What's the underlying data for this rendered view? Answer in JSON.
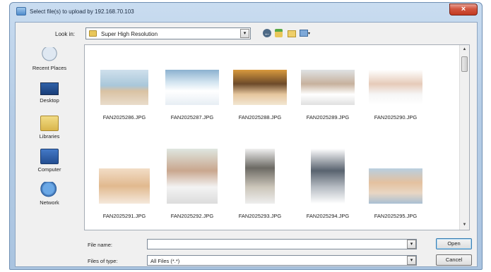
{
  "window": {
    "title": "Select file(s) to upload by 192.168.70.103",
    "close_glyph": "×"
  },
  "toolbar": {
    "look_in_label": "Look in:",
    "look_in_value": "Super High Resolution",
    "dropdown_glyph": "▾",
    "back_glyph": "←"
  },
  "places": [
    {
      "label": "Recent Places",
      "icon": "recent-places-icon"
    },
    {
      "label": "Desktop",
      "icon": "desktop-icon"
    },
    {
      "label": "Libraries",
      "icon": "libraries-icon"
    },
    {
      "label": "Computer",
      "icon": "computer-icon"
    },
    {
      "label": "Network",
      "icon": "network-icon"
    }
  ],
  "files": [
    {
      "name": "FAN2025286.JPG"
    },
    {
      "name": "FAN2025287.JPG"
    },
    {
      "name": "FAN2025288.JPG"
    },
    {
      "name": "FAN2025289.JPG"
    },
    {
      "name": "FAN2025290.JPG"
    },
    {
      "name": "FAN2025291.JPG"
    },
    {
      "name": "FAN2025292.JPG"
    },
    {
      "name": "FAN2025293.JPG"
    },
    {
      "name": "FAN2025294.JPG"
    },
    {
      "name": "FAN2025295.JPG"
    }
  ],
  "scrollbar": {
    "up_glyph": "▲",
    "down_glyph": "▼"
  },
  "form": {
    "file_name_label": "File name:",
    "file_name_value": "",
    "file_type_label": "Files of type:",
    "file_type_value": "All Files (*.*)",
    "open_label": "Open",
    "cancel_label": "Cancel"
  }
}
